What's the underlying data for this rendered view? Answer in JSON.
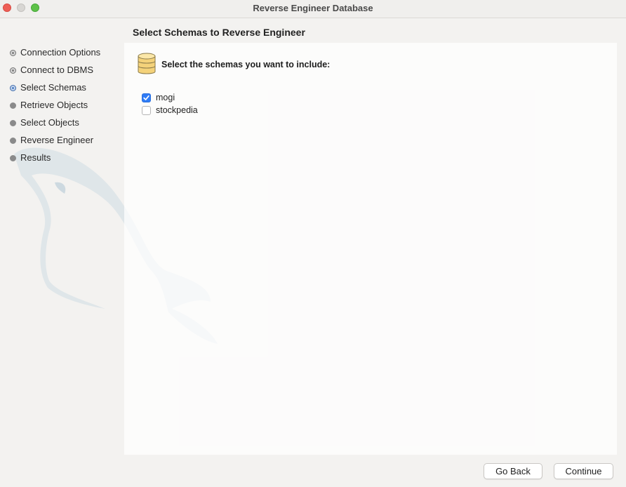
{
  "window": {
    "title": "Reverse Engineer Database"
  },
  "steps": [
    {
      "label": "Connection Options",
      "state": "done"
    },
    {
      "label": "Connect to DBMS",
      "state": "done"
    },
    {
      "label": "Select Schemas",
      "state": "current"
    },
    {
      "label": "Retrieve Objects",
      "state": "pending"
    },
    {
      "label": "Select Objects",
      "state": "pending"
    },
    {
      "label": "Reverse Engineer",
      "state": "pending"
    },
    {
      "label": "Results",
      "state": "pending"
    }
  ],
  "page": {
    "heading": "Select Schemas to Reverse Engineer",
    "instruction": "Select the schemas you want to include:",
    "icon": "database-icon"
  },
  "schemas": [
    {
      "name": "mogi",
      "checked": true
    },
    {
      "name": "stockpedia",
      "checked": false
    }
  ],
  "buttons": {
    "back": "Go Back",
    "continue": "Continue"
  },
  "colors": {
    "accent": "#2f7cf6",
    "current_step": "#4e7fc4",
    "close": "#ee5f57",
    "zoom": "#5ec249"
  }
}
